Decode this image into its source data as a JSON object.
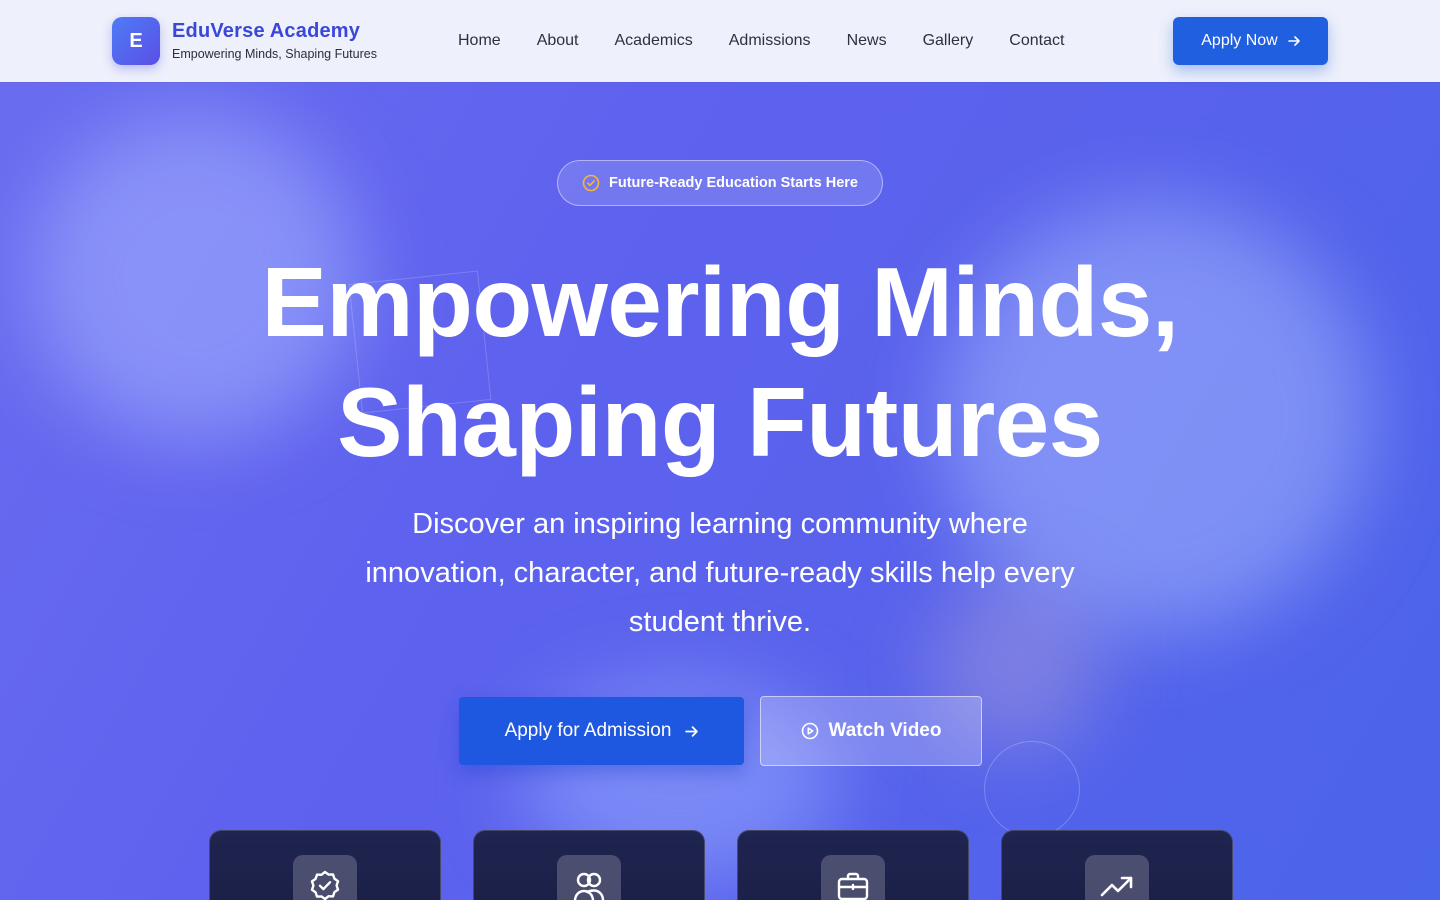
{
  "header": {
    "logo_letter": "E",
    "brand_name": "EduVerse Academy",
    "brand_tagline": "Empowering Minds, Shaping Futures",
    "nav": [
      {
        "label": "Home"
      },
      {
        "label": "About"
      },
      {
        "label": "Academics"
      },
      {
        "label": "Admissions"
      },
      {
        "label": "News"
      },
      {
        "label": "Gallery"
      },
      {
        "label": "Contact"
      }
    ],
    "apply_now_label": "Apply Now"
  },
  "hero": {
    "badge_text": "Future-Ready Education Starts Here",
    "headline_line1": "Empowering Minds,",
    "headline_line2": "Shaping Futures",
    "subtext": "Discover an inspiring learning community where innovation, character, and future-ready skills help every student thrive.",
    "primary_button_label": "Apply for Admission",
    "secondary_button_label": "Watch Video"
  },
  "feature_cards": [
    {
      "icon": "badge-check-icon"
    },
    {
      "icon": "users-icon"
    },
    {
      "icon": "briefcase-icon"
    },
    {
      "icon": "trending-up-icon"
    }
  ],
  "colors": {
    "brand": "#3a47d8",
    "primary_button": "#1f58e0",
    "hero_bg": "#5e62ee",
    "card_bg": "#1f2450",
    "badge_icon": "#f5b731"
  }
}
